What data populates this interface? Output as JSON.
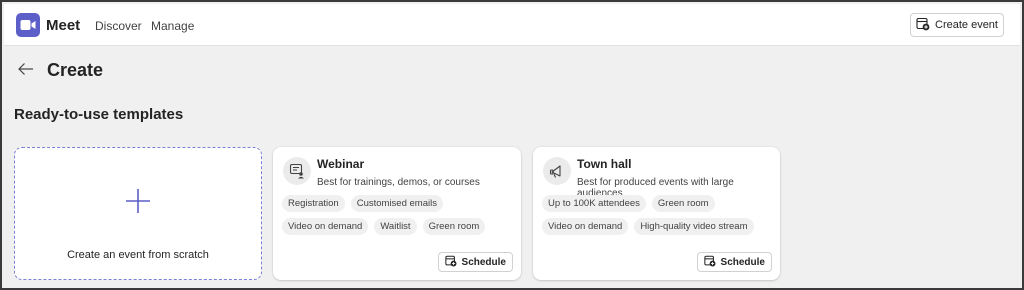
{
  "app": {
    "name": "Meet",
    "logo_icon": "video-camera-icon",
    "brand_color": "#5b5fc7"
  },
  "nav": {
    "items": [
      {
        "label": "Discover"
      },
      {
        "label": "Manage"
      }
    ]
  },
  "toolbar": {
    "create_event_label": "Create event",
    "create_event_icon": "calendar-add-icon"
  },
  "header": {
    "back_icon": "arrow-left-icon",
    "title": "Create"
  },
  "templates": {
    "section_title": "Ready-to-use templates",
    "scratch": {
      "label": "Create an event from scratch",
      "icon": "plus-icon"
    },
    "cards": [
      {
        "title": "Webinar",
        "description": "Best for trainings, demos, or courses",
        "icon": "presenter-icon",
        "tags": [
          "Registration",
          "Customised emails",
          "Video on demand",
          "Waitlist",
          "Green room"
        ],
        "schedule_label": "Schedule"
      },
      {
        "title": "Town hall",
        "description": "Best for produced events with large audiences",
        "icon": "megaphone-icon",
        "tags": [
          "Up to 100K attendees",
          "Green room",
          "Video on demand",
          "High-quality video stream"
        ],
        "schedule_label": "Schedule"
      }
    ]
  }
}
